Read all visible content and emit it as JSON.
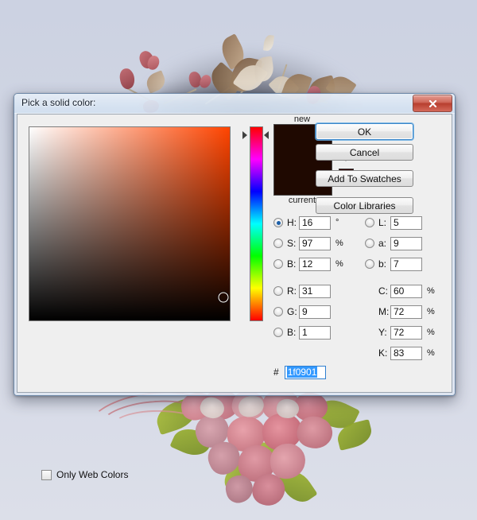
{
  "dialog": {
    "title": "Pick a solid color:",
    "close_label": "x",
    "close_icon": "close-icon"
  },
  "preview": {
    "new_label": "new",
    "current_label": "current",
    "new_color": "#1f0901",
    "current_color": "#1f0901",
    "web_safe_icon": "cube-icon",
    "web_safe_swatch": "#330000"
  },
  "picker": {
    "hue_degrees": 16,
    "saturation_percent": 97,
    "brightness_percent": 12,
    "cursor_x_percent": 97,
    "cursor_y_percent": 88,
    "hue_marker_percent": 4.4,
    "selected_mode": "H"
  },
  "hsb": [
    {
      "key": "H",
      "label": "H:",
      "value": "16",
      "unit": "°",
      "selected": true
    },
    {
      "key": "S",
      "label": "S:",
      "value": "97",
      "unit": "%",
      "selected": false
    },
    {
      "key": "B",
      "label": "B:",
      "value": "12",
      "unit": "%",
      "selected": false
    }
  ],
  "rgb": [
    {
      "key": "R",
      "label": "R:",
      "value": "31",
      "unit": "",
      "selected": false
    },
    {
      "key": "G",
      "label": "G:",
      "value": "9",
      "unit": "",
      "selected": false
    },
    {
      "key": "B",
      "label": "B:",
      "value": "1",
      "unit": "",
      "selected": false
    }
  ],
  "lab": [
    {
      "key": "L",
      "label": "L:",
      "value": "5",
      "unit": "",
      "selected": false
    },
    {
      "key": "a",
      "label": "a:",
      "value": "9",
      "unit": "",
      "selected": false
    },
    {
      "key": "b",
      "label": "b:",
      "value": "7",
      "unit": "",
      "selected": false
    }
  ],
  "cmyk": [
    {
      "key": "C",
      "label": "C:",
      "value": "60",
      "unit": "%"
    },
    {
      "key": "M",
      "label": "M:",
      "value": "72",
      "unit": "%"
    },
    {
      "key": "Y",
      "label": "Y:",
      "value": "72",
      "unit": "%"
    },
    {
      "key": "K",
      "label": "K:",
      "value": "83",
      "unit": "%"
    }
  ],
  "hex": {
    "hash": "#",
    "value": "1f0901"
  },
  "only_web_colors": {
    "label": "Only Web Colors",
    "checked": false
  },
  "buttons": {
    "ok": "OK",
    "cancel": "Cancel",
    "add_to_swatches": "Add To Swatches",
    "color_libraries": "Color Libraries"
  },
  "colors": {
    "accent": "#3d87c9",
    "hex_selection": "#3399ff",
    "desktop": "#d3d8e5"
  }
}
